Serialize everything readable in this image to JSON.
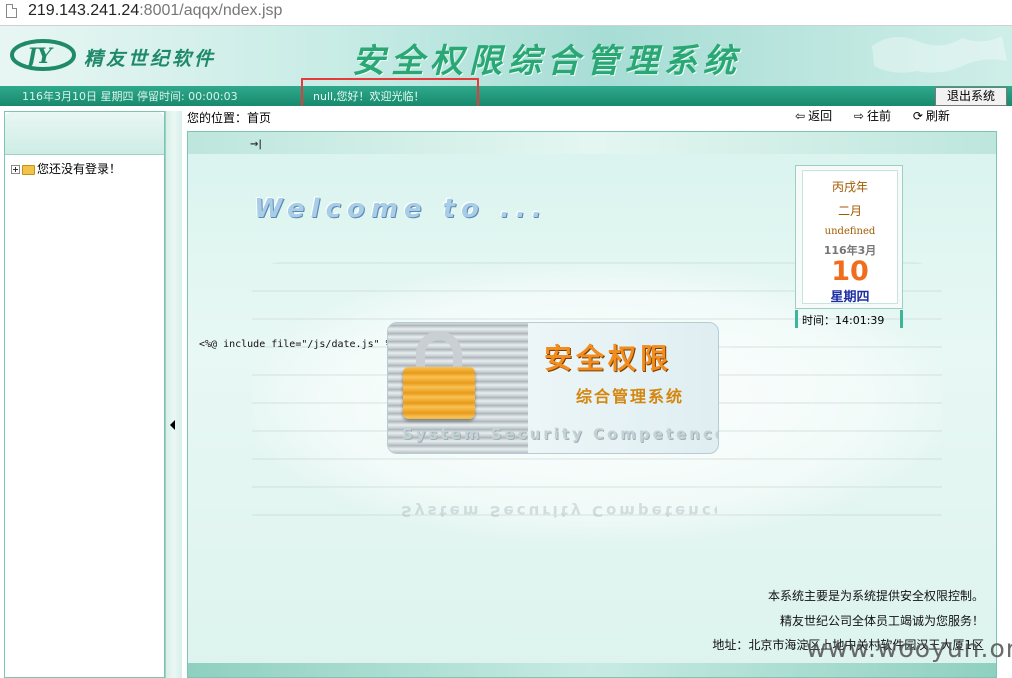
{
  "address_bar": {
    "url_host": "219.143.241.24",
    "url_rest": ":8001/aqqx/ndex.jsp"
  },
  "header": {
    "logo_letters": "JY",
    "logo_text": "精友世纪软件",
    "system_title": "安全权限综合管理系统"
  },
  "status": {
    "date_info": "116年3月10日  星期四   停留时间: 00:00:03",
    "greeting": "null,您好！欢迎光临！",
    "logout_label": "退出系统"
  },
  "sidebar": {
    "tree_items": [
      {
        "label": "您还没有登录！"
      }
    ]
  },
  "location": {
    "text": "您的位置：首页",
    "back_label": "返回",
    "forward_label": "往前",
    "refresh_label": "刷新"
  },
  "main": {
    "welcome": "Welcome to ...",
    "include_text": "<%@ include file=\"/js/date.js\" %>",
    "logo_title": "安全权限",
    "logo_subtitle": "综合管理系统",
    "logo_english": "System  Security  Competence"
  },
  "calendar": {
    "ganzhi_year": "丙戌年",
    "lunar_month": "二月",
    "lunar_day": "undefined",
    "year_month": "116年3月",
    "day": "10",
    "weekday": "星期四",
    "time_label": "时间：14:01:39"
  },
  "footer": {
    "line1": "本系统主要是为系统提供安全权限控制。",
    "line2": "精友世纪公司全体员工竭诚为您服务！",
    "line3": "地址：北京市海淀区上地中关村软件园汉王大厦1区"
  },
  "watermark": "www.wooyun.org",
  "colors": {
    "accent": "#2aa774",
    "statusbar": "#18896d",
    "highlight_box": "#e53b3b"
  }
}
